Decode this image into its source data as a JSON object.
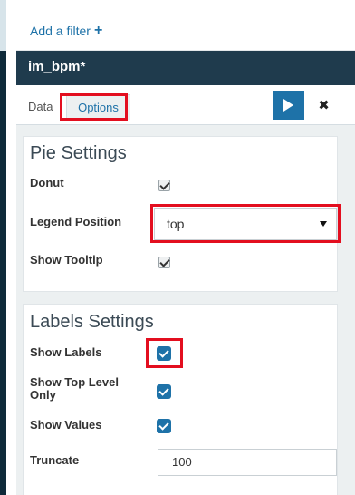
{
  "filter_bar": {
    "add_filter_label": "Add a filter",
    "plus_icon": "plus-icon"
  },
  "title_bar": {
    "title": "im_bpm*"
  },
  "tabs": {
    "data_label": "Data",
    "options_label": "Options",
    "run_icon": "play-icon",
    "close_icon": "close-icon",
    "close_glyph": "✖"
  },
  "pie_settings": {
    "title": "Pie Settings",
    "donut": {
      "label": "Donut",
      "checked": true
    },
    "legend_position": {
      "label": "Legend Position",
      "value": "top"
    },
    "show_tooltip": {
      "label": "Show Tooltip",
      "checked": true
    }
  },
  "labels_settings": {
    "title": "Labels Settings",
    "show_labels": {
      "label": "Show Labels",
      "checked": true
    },
    "show_top_level_only": {
      "label": "Show Top Level Only",
      "checked": true
    },
    "show_values": {
      "label": "Show Values",
      "checked": true
    },
    "truncate": {
      "label": "Truncate",
      "value": "100"
    }
  },
  "colors": {
    "accent": "#1e72a8",
    "title_bar": "#1f3b4d",
    "highlight": "#e30e1f"
  }
}
